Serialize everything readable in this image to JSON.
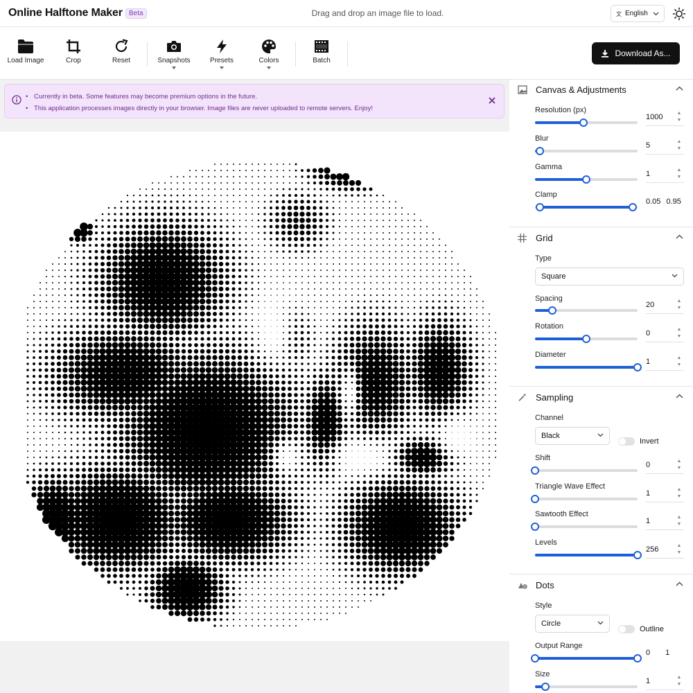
{
  "header": {
    "title": "Online Halftone Maker",
    "badge": "Beta",
    "drop_hint": "Drag and drop an image file to load.",
    "language": "English"
  },
  "toolbar": {
    "load_image": "Load Image",
    "crop": "Crop",
    "reset": "Reset",
    "snapshots": "Snapshots",
    "presets": "Presets",
    "colors": "Colors",
    "batch": "Batch",
    "download": "Download As..."
  },
  "notice": {
    "items": [
      "Currently in beta. Some features may become premium options in the future.",
      "This application processes images directly in your browser. Image files are never uploaded to remote servers. Enjoy!"
    ]
  },
  "panel": {
    "canvas": {
      "title": "Canvas & Adjustments",
      "resolution": {
        "label": "Resolution (px)",
        "value": "1000",
        "level": 0.47
      },
      "blur": {
        "label": "Blur",
        "value": "5",
        "level": 0.05
      },
      "gamma": {
        "label": "Gamma",
        "value": "1",
        "level": 0.5
      },
      "clamp": {
        "label": "Clamp",
        "min": "0.05",
        "max": "0.95",
        "low": 0.05,
        "high": 0.95
      }
    },
    "grid": {
      "title": "Grid",
      "type_label": "Type",
      "type_value": "Square",
      "spacing": {
        "label": "Spacing",
        "value": "20",
        "level": 0.17
      },
      "rotation": {
        "label": "Rotation",
        "value": "0",
        "level": 0.5
      },
      "diameter": {
        "label": "Diameter",
        "value": "1",
        "level": 1.0
      }
    },
    "sampling": {
      "title": "Sampling",
      "channel_label": "Channel",
      "channel_value": "Black",
      "invert_label": "Invert",
      "shift": {
        "label": "Shift",
        "value": "0",
        "level": 0.0
      },
      "triangle": {
        "label": "Triangle Wave Effect",
        "value": "1",
        "level": 0.0
      },
      "sawtooth": {
        "label": "Sawtooth Effect",
        "value": "1",
        "level": 0.0
      },
      "levels": {
        "label": "Levels",
        "value": "256",
        "level": 1.0
      }
    },
    "dots": {
      "title": "Dots",
      "style_label": "Style",
      "style_value": "Circle",
      "outline_label": "Outline",
      "output_range": {
        "label": "Output Range",
        "min": "0",
        "max": "1",
        "low": 0.0,
        "high": 1.0
      },
      "size": {
        "label": "Size",
        "value": "1",
        "level": 0.1
      }
    }
  },
  "colors": {
    "accent": "#1f5fd6",
    "notice_bg": "#f4e4fb",
    "notice_text": "#6a2e8c",
    "dot_color": "#000000"
  }
}
